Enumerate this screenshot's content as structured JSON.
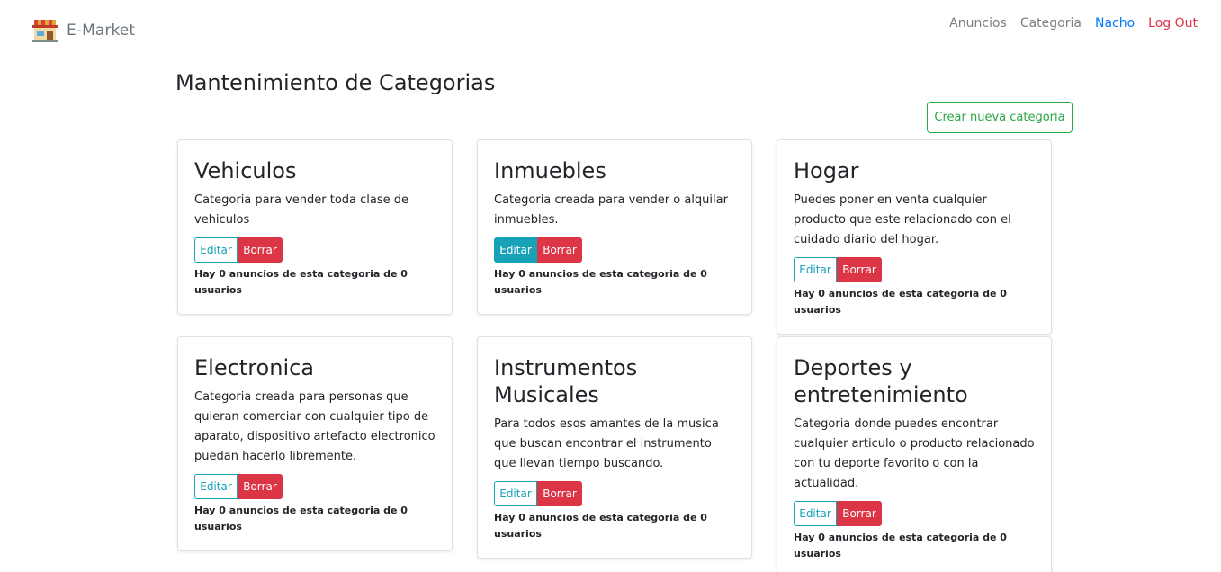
{
  "brand": {
    "name": "E-Market",
    "logo_icon": "store-icon"
  },
  "nav": {
    "anuncios": "Anuncios",
    "categoria": "Categoria",
    "user": "Nacho",
    "logout": "Log Out"
  },
  "page": {
    "title": "Mantenimiento de Categorias",
    "create_button": "Crear nueva categoria"
  },
  "colors": {
    "primary": "#007bff",
    "info": "#17a2b8",
    "danger": "#dc3545",
    "success": "#28a745",
    "muted": "#6c757d"
  },
  "categories": [
    {
      "title": "Vehiculos",
      "description": "Categoria para vender toda clase de vehiculos",
      "edit_label": "Editar",
      "delete_label": "Borrar",
      "summary": "Hay 0 anuncios de esta categoria de 0 usuarios"
    },
    {
      "title": "Inmuebles",
      "description": "Categoria creada para vender o alquilar inmuebles.",
      "edit_label": "Editar",
      "delete_label": "Borrar",
      "summary": "Hay 0 anuncios de esta categoria de 0 usuarios"
    },
    {
      "title": "Hogar",
      "description": "Puedes poner en venta cualquier producto que este relacionado con el cuidado diario del hogar.",
      "edit_label": "Editar",
      "delete_label": "Borrar",
      "summary": "Hay 0 anuncios de esta categoria de 0 usuarios"
    },
    {
      "title": "Electronica",
      "description": "Categoria creada para personas que quieran comerciar con cualquier tipo de aparato, dispositivo artefacto electronico puedan hacerlo libremente.",
      "edit_label": "Editar",
      "delete_label": "Borrar",
      "summary": "Hay 0 anuncios de esta categoria de 0 usuarios"
    },
    {
      "title": "Instrumentos Musicales",
      "description": "Para todos esos amantes de la musica que buscan encontrar el instrumento que llevan tiempo buscando.",
      "edit_label": "Editar",
      "delete_label": "Borrar",
      "summary": "Hay 0 anuncios de esta categoria de 0 usuarios"
    },
    {
      "title": "Deportes y entretenimiento",
      "description": "Categoria donde puedes encontrar cualquier articulo o producto relacionado con tu deporte favorito o con la actualidad.",
      "edit_label": "Editar",
      "delete_label": "Borrar",
      "summary": "Hay 0 anuncios de esta categoria de 0 usuarios"
    }
  ]
}
